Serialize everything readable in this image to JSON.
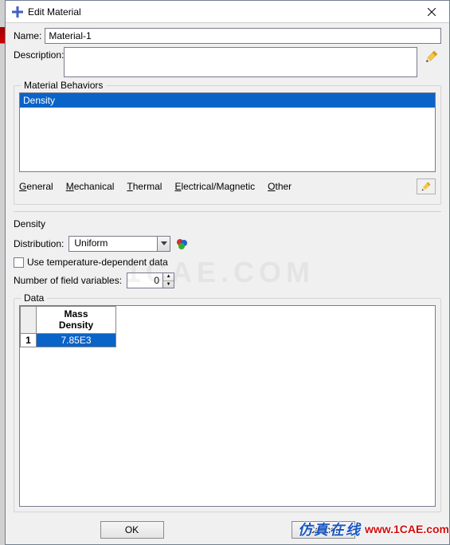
{
  "window": {
    "title": "Edit Material"
  },
  "fields": {
    "name_label": "Name:",
    "name_value": "Material-1",
    "description_label": "Description:",
    "description_value": ""
  },
  "behaviors": {
    "legend": "Material Behaviors",
    "items": [
      "Density"
    ],
    "selected_index": 0
  },
  "tabs": {
    "general": "General",
    "mechanical": "Mechanical",
    "thermal": "Thermal",
    "electrical": "Electrical/Magnetic",
    "other": "Other"
  },
  "density": {
    "section_title": "Density",
    "distribution_label": "Distribution:",
    "distribution_value": "Uniform",
    "temp_dep_label": "Use temperature-dependent data",
    "field_vars_label": "Number of field variables:",
    "field_vars_value": "0",
    "data_legend": "Data",
    "col1_line1": "Mass",
    "col1_line2": "Density",
    "row1_index": "1",
    "row1_value": "7.85E3"
  },
  "buttons": {
    "ok": "OK",
    "cancel": "Cancel"
  },
  "watermark": {
    "center": "1CAE.COM",
    "zh": "仿真在线",
    "url": "www.1CAE.com"
  }
}
